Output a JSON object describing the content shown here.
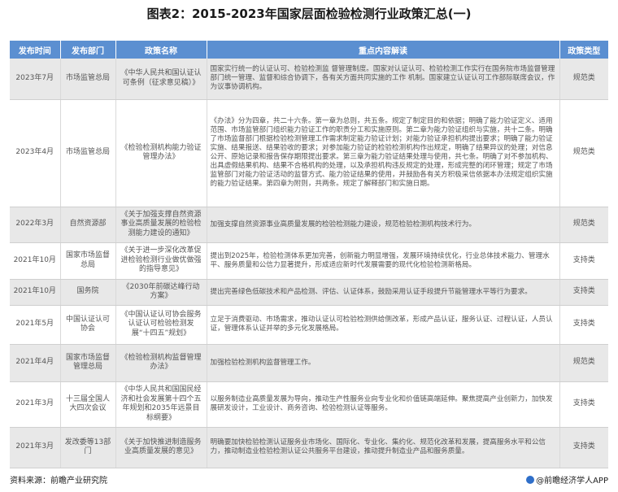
{
  "title": "图表2：2015-2023年国家层面检验检测行业政策汇总(一)",
  "columns": [
    "发布时间",
    "发布部门",
    "政策名称",
    "重点内容解读",
    "政策类型"
  ],
  "rows": [
    {
      "date": "2023年7月",
      "dept": "市场监管总局",
      "name": "《中华人民共和国认证认可条例（征求意见稿）》",
      "content": "国家实行统一的认证认可、检验检测监 督管理制度。国家对认证认可、检验检测工作实行在国务院市场监督管理部门统一管理、监督和综合协调下，各有关方面共同实施的工作 机制。国家建立认证认可工作部际联席会议，作为议事协调机构。",
      "type": "规范类"
    },
    {
      "date": "2023年4月",
      "dept": "市场监管总局",
      "name": "《检验检测机构能力验证管理办法》",
      "content": "《办法》分为四章，共二十六条。第一章为总则，共五条。规定了制定目的和依据；明确了能力验证定义、适用范围、市场监管部门组织能力验证工作的职责分工和实施原则。第二章为能力验证组织与实施，共十二条。明确了市场监督部门根据检验检测管理工作需求制定能力验证计划；对能力验证承担机构提出要求；明确了能力验证实施、结果报送、结果验收的要求；对参加能力验证的检验检测机构作出规定，明确了结果异议的处理；对信息公开、原始记录和报告保存期限提出要求。第三章为能力验证结果处理与使用，共七条。明确了对不参加机构、出具虚假结果机构、结果不合格机构的处理，以及承担机构违反规定的处理，形成完整的闭环管理；规定了市场监管部门对能力验证活动的监督方式、能力验证结果的使用，并鼓励各有关方积极采信依据本办法规定组织实施的能力验证结果。第四章为附则，共两条。规定了解释部门和实施日期。",
      "type": "规范类"
    },
    {
      "date": "2022年3月",
      "dept": "自然资源部",
      "name": "《关于加强支撑自然资源事业高质量发展的检验检测能力建设的通知》",
      "content": "加强支撑自然资源事业高质量发展的检验检测能力建设，规范检验检测机构技术行为。",
      "type": "规范类"
    },
    {
      "date": "2021年10月",
      "dept": "国家市场监督总局",
      "name": "《关于进一步深化改革促进检验检测行业做优做强的指导意见》",
      "content": "提出到2025年，检验检测体系更加完善，创新能力明显增强，发展环境持续优化，行业总体技术能力、管理水平、服务质量和公信力显著提升，形成适应新时代发展需要的现代化检验检测新格局。",
      "type": "支持类"
    },
    {
      "date": "2021年10月",
      "dept": "国务院",
      "name": "《2030年前碳达峰行动方案》",
      "content": "提出完善绿色低碳技术和产品检测、评估、认证体系，鼓励采用认证手段提升节能管理水平等行为要求。",
      "type": "支持类"
    },
    {
      "date": "2021年5月",
      "dept": "中国认证认可协会",
      "name": "《中国认证认可协会服务认证认可检验检测发展“十四五”规划》",
      "content": "立足于消费驱动、市场需求，推动认证认可检验检测供给侧改革，形成产品认证，服务认证、过程认证，人员认证，管理体系认证并举的多元化发展格局。",
      "type": "支持类"
    },
    {
      "date": "2021年4月",
      "dept": "国家市场监督管理总局",
      "name": "《检验检测机构监督管理办法》",
      "content": "加强检验检测机构监督管理工作。",
      "type": "规范类"
    },
    {
      "date": "2021年3月",
      "dept": "十三届全国人大四次会议",
      "name": "《中华人民共和国国民经济和社会发展第十四个五年规划和2035年远景目标纲要》",
      "content": "以服务制造业高质量发展为导向，推动生产性服务业向专业化和价值链高端延伸。聚焦提高产业创新力，加快发展研发设计，工业设计、商务咨询、检验检测认证等服务。",
      "type": "支持类"
    },
    {
      "date": "2021年3月",
      "dept": "发改委等13部门",
      "name": "《关于加快推进制造服务业高质量发展的意见》",
      "content": "明确要加快检验检测认证服务业市场化、国际化、专业化、集约化、规范化改革和发展，提高服务水平和公信力，推动制造业检验检测认证公共服务平台建设，推动提升制造业产品和服务质量。",
      "type": "支持类"
    }
  ],
  "footer": {
    "source": "资料来源：前瞻产业研究院",
    "app": "@前瞻经济学人APP"
  }
}
